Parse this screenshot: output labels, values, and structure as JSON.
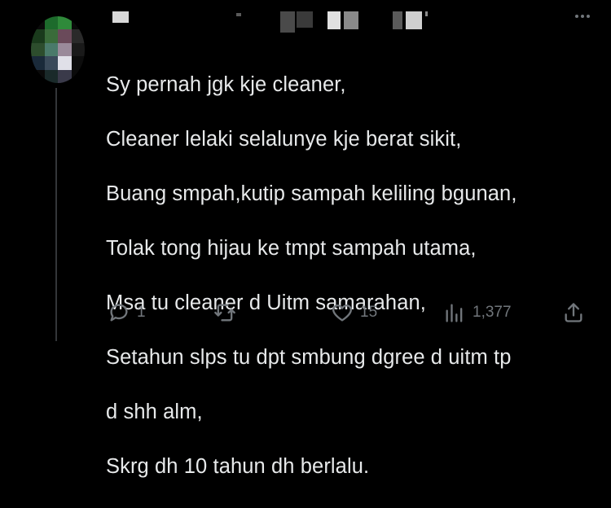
{
  "tweet": {
    "lines": [
      "Sy pernah jgk kje cleaner,",
      "Cleaner lelaki selalunye kje berat sikit,",
      "Buang smpah,kutip sampah keliling bgunan,",
      "Tolak tong hijau ke tmpt sampah utama,",
      "Msa tu cleaner d Uitm samarahan,",
      "Setahun slps tu dpt smbung dgree d uitm tp",
      "d shh alm,",
      "Skrg dh 10 tahun dh berlalu."
    ]
  },
  "actions": {
    "reply": {
      "icon": "reply-icon",
      "count": "1"
    },
    "retweet": {
      "icon": "retweet-icon",
      "count": ""
    },
    "like": {
      "icon": "heart-icon",
      "count": "15"
    },
    "views": {
      "icon": "views-icon",
      "count": "1,377"
    },
    "share": {
      "icon": "share-icon"
    }
  },
  "colors": {
    "background": "#000000",
    "text": "#e7e9ea",
    "muted": "#71767b",
    "thread_line": "#333639"
  }
}
